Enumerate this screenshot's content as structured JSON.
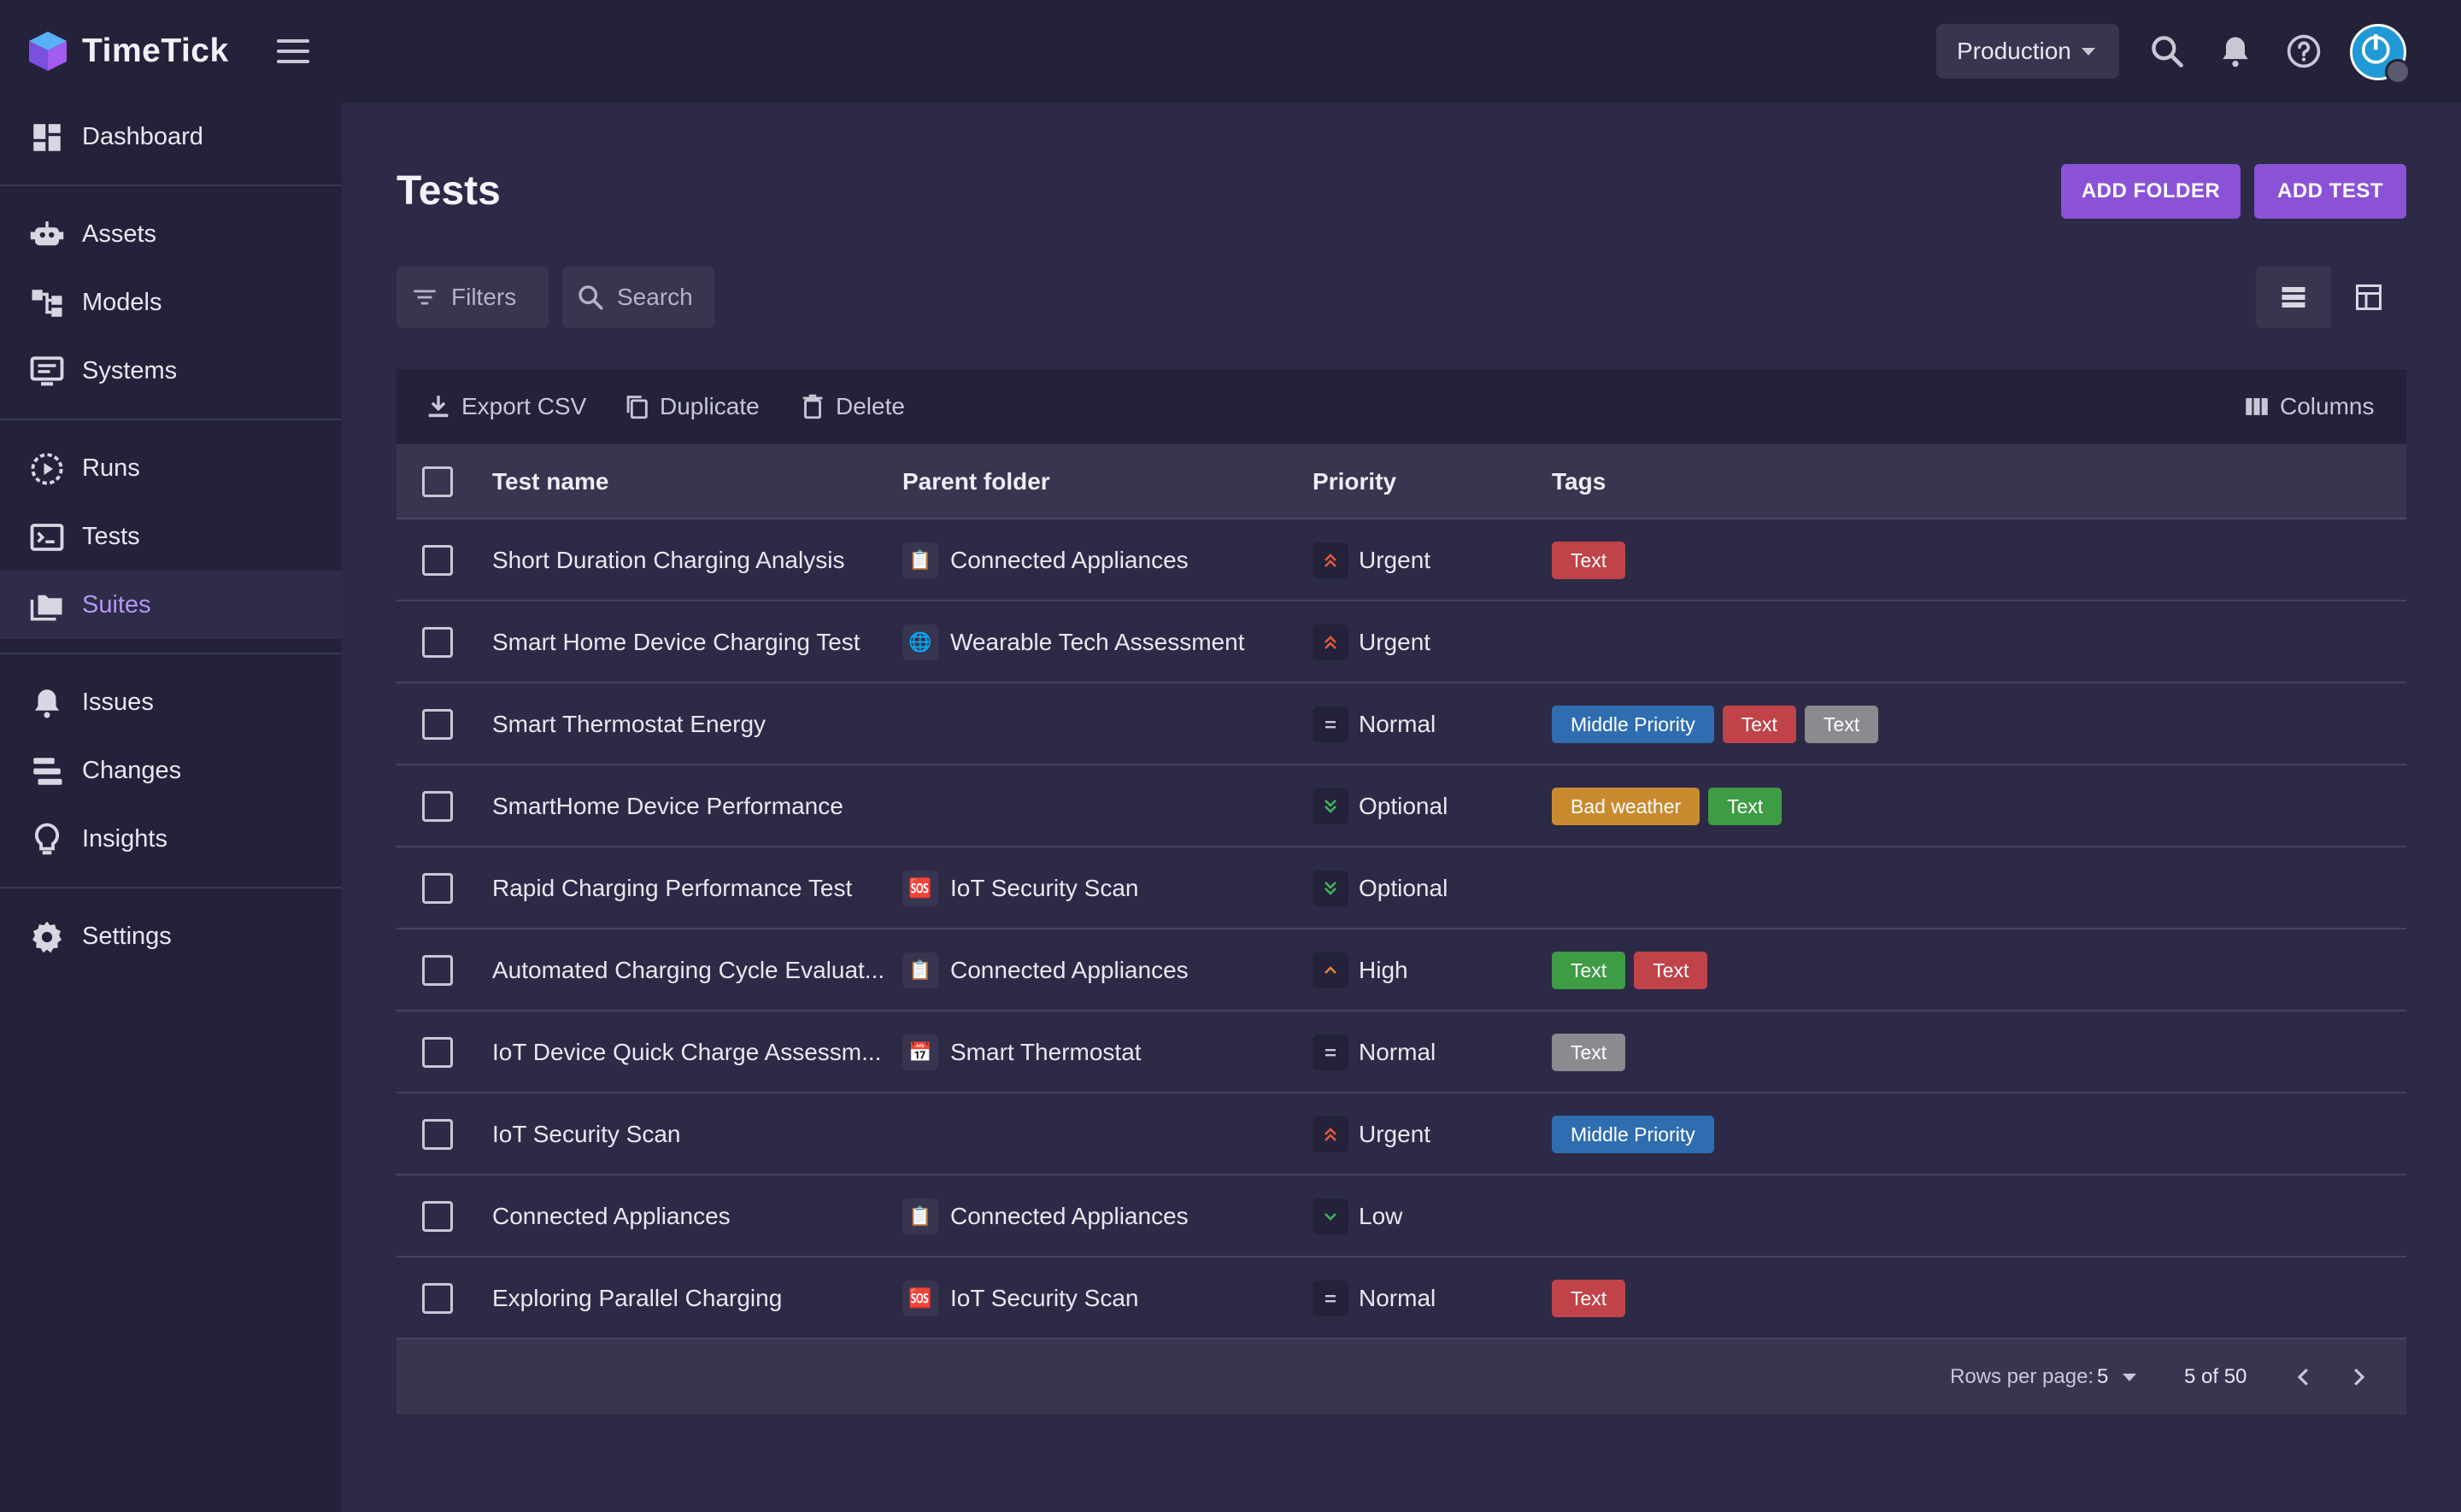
{
  "app": {
    "name": "TimeTick"
  },
  "header": {
    "environment": "Production"
  },
  "sidebar": {
    "items": [
      {
        "label": "Dashboard",
        "icon": "dashboard-icon"
      },
      {
        "label": "Assets",
        "icon": "robot-icon"
      },
      {
        "label": "Models",
        "icon": "hierarchy-icon"
      },
      {
        "label": "Systems",
        "icon": "monitor-icon"
      },
      {
        "label": "Runs",
        "icon": "play-circle-icon"
      },
      {
        "label": "Tests",
        "icon": "terminal-icon"
      },
      {
        "label": "Suites",
        "icon": "folders-icon",
        "active": true
      },
      {
        "label": "Issues",
        "icon": "bell-icon"
      },
      {
        "label": "Changes",
        "icon": "changes-icon"
      },
      {
        "label": "Insights",
        "icon": "lightbulb-icon"
      },
      {
        "label": "Settings",
        "icon": "gear-icon"
      }
    ]
  },
  "main": {
    "title": "Tests",
    "add_folder": "ADD FOLDER",
    "add_test": "ADD TEST",
    "filters": "Filters",
    "search": "Search"
  },
  "table": {
    "toolbar": {
      "export": "Export CSV",
      "duplicate": "Duplicate",
      "delete": "Delete",
      "columns": "Columns"
    },
    "headers": {
      "name": "Test name",
      "folder": "Parent folder",
      "priority": "Priority",
      "tags": "Tags"
    },
    "rows": [
      {
        "name": "Short Duration Charging Analysis",
        "folder": "Connected Appliances",
        "folder_icon": "clipboard",
        "priority": "Urgent",
        "tags": [
          {
            "text": "Text",
            "color": "#c0434a"
          }
        ]
      },
      {
        "name": "Smart Home Device Charging Test",
        "folder": "Wearable Tech Assessment",
        "folder_icon": "globe",
        "priority": "Urgent",
        "tags": []
      },
      {
        "name": "Smart Thermostat Energy",
        "folder": "",
        "folder_icon": "",
        "priority": "Normal",
        "tags": [
          {
            "text": "Middle Priority",
            "color": "#2f6db0"
          },
          {
            "text": "Text",
            "color": "#c0434a"
          },
          {
            "text": "Text",
            "color": "#8a8a8f"
          }
        ]
      },
      {
        "name": "SmartHome Device Performance",
        "folder": "",
        "folder_icon": "",
        "priority": "Optional",
        "tags": [
          {
            "text": "Bad weather",
            "color": "#c98a2f"
          },
          {
            "text": "Text",
            "color": "#3e9c45"
          }
        ]
      },
      {
        "name": "Rapid Charging Performance Test",
        "folder": "IoT Security Scan",
        "folder_icon": "sos",
        "priority": "Optional",
        "tags": []
      },
      {
        "name": "Automated Charging Cycle Evaluat...",
        "folder": "Connected Appliances",
        "folder_icon": "clipboard",
        "priority": "High",
        "tags": [
          {
            "text": "Text",
            "color": "#3e9c45"
          },
          {
            "text": "Text",
            "color": "#c0434a"
          }
        ]
      },
      {
        "name": "IoT Device Quick Charge Assessm...",
        "folder": "Smart Thermostat",
        "folder_icon": "calendar",
        "priority": "Normal",
        "tags": [
          {
            "text": "Text",
            "color": "#8a8a8f"
          }
        ]
      },
      {
        "name": "IoT Security Scan",
        "folder": "",
        "folder_icon": "",
        "priority": "Urgent",
        "tags": [
          {
            "text": "Middle Priority",
            "color": "#2f6db0"
          }
        ]
      },
      {
        "name": "Connected Appliances",
        "folder": "Connected Appliances",
        "folder_icon": "clipboard",
        "priority": "Low",
        "tags": []
      },
      {
        "name": "Exploring Parallel Charging",
        "folder": "IoT Security Scan",
        "folder_icon": "sos",
        "priority": "Normal",
        "tags": [
          {
            "text": "Text",
            "color": "#c0434a"
          }
        ]
      }
    ],
    "footer": {
      "rows_per_page_label": "Rows per page:",
      "rows_per_page": "5",
      "range": "5 of 50"
    }
  },
  "colors": {
    "accent": "#8b52d6",
    "active_nav": "#b794f6",
    "urgent": "#e2583e",
    "high": "#e8823a",
    "optional": "#3fb559",
    "low": "#3fb559"
  }
}
